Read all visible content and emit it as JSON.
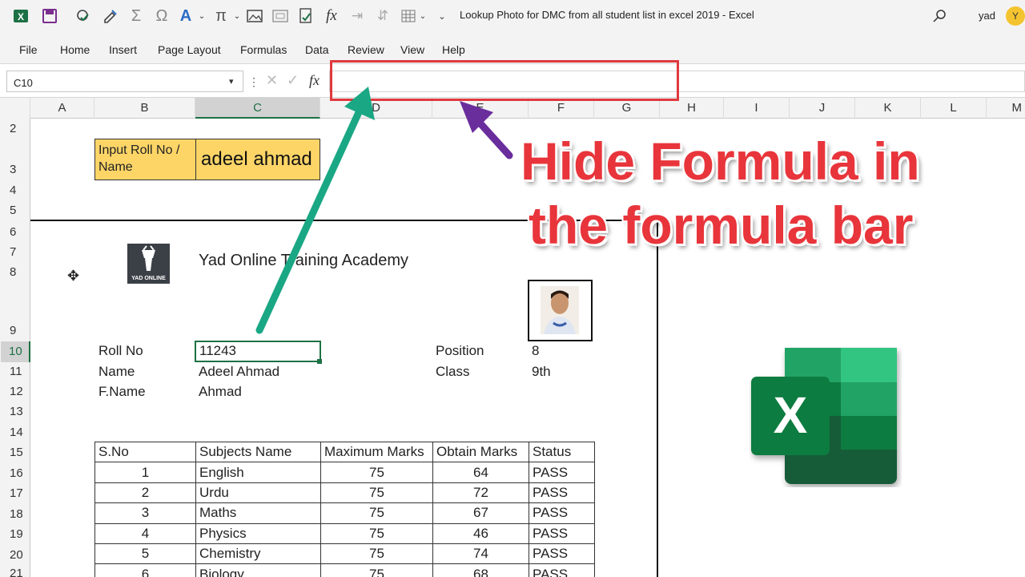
{
  "titlebar": {
    "document_title": "Lookup Photo for DMC from all student list in excel 2019  -  Excel",
    "user_name": "yad",
    "user_initial": "Y",
    "qa_icons": [
      "excel-app-icon",
      "save-icon",
      "spelling-check-icon",
      "format-painter-icon",
      "autosum-icon",
      "omega-symbol-icon",
      "font-color-icon",
      "chevron-down-icon",
      "pi-equation-icon",
      "chevron-down-icon",
      "image-icon",
      "screenshot-icon",
      "formula-check-icon",
      "fx-icon",
      "remove-arrows-icon",
      "trace-arrows-icon",
      "table-grid-icon",
      "chevron-down-icon",
      "customize-toolbar-icon"
    ]
  },
  "ribbon": {
    "tabs": [
      "File",
      "Home",
      "Insert",
      "Page Layout",
      "Formulas",
      "Data",
      "Review",
      "View",
      "Help"
    ]
  },
  "formula_bar": {
    "name_box": "C10",
    "formula_value": "",
    "fx_label": "fx"
  },
  "columns": [
    "A",
    "B",
    "C",
    "D",
    "E",
    "F",
    "G",
    "H",
    "I",
    "J",
    "K",
    "L",
    "M"
  ],
  "rows": [
    "2",
    "3",
    "4",
    "5",
    "6",
    "7",
    "8",
    "9",
    "10",
    "11",
    "12",
    "13",
    "14",
    "15",
    "16",
    "17",
    "18",
    "19",
    "20",
    "21"
  ],
  "lookup": {
    "label": "Input Roll No / Name",
    "value": "adeel ahmad"
  },
  "academy": {
    "logo_text": "YAD ONLINE",
    "name": "Yad Online Training Academy"
  },
  "student": {
    "roll_label": "Roll No",
    "roll_value": "11243",
    "name_label": "Name",
    "name_value": "Adeel Ahmad",
    "fname_label": "F.Name",
    "fname_value": "Ahmad",
    "position_label": "Position",
    "position_value": "8",
    "class_label": "Class",
    "class_value": "9th"
  },
  "marks_table": {
    "headers": [
      "S.No",
      "Subjects Name",
      "Maximum Marks",
      "Obtain Marks",
      "Status"
    ],
    "rows": [
      [
        "1",
        "English",
        "75",
        "64",
        "PASS"
      ],
      [
        "2",
        "Urdu",
        "75",
        "72",
        "PASS"
      ],
      [
        "3",
        "Maths",
        "75",
        "67",
        "PASS"
      ],
      [
        "4",
        "Physics",
        "75",
        "46",
        "PASS"
      ],
      [
        "5",
        "Chemistry",
        "75",
        "74",
        "PASS"
      ],
      [
        "6",
        "Biology",
        "75",
        "68",
        "PASS"
      ]
    ]
  },
  "overlay": {
    "line1": "Hide Formula in",
    "line2": "the formula bar"
  },
  "colors": {
    "excel_green": "#1e7145",
    "highlight_yellow": "#fdd567",
    "annotation_red": "#e8353b",
    "arrow_teal": "#1aa784",
    "arrow_purple": "#6a2d9c"
  }
}
